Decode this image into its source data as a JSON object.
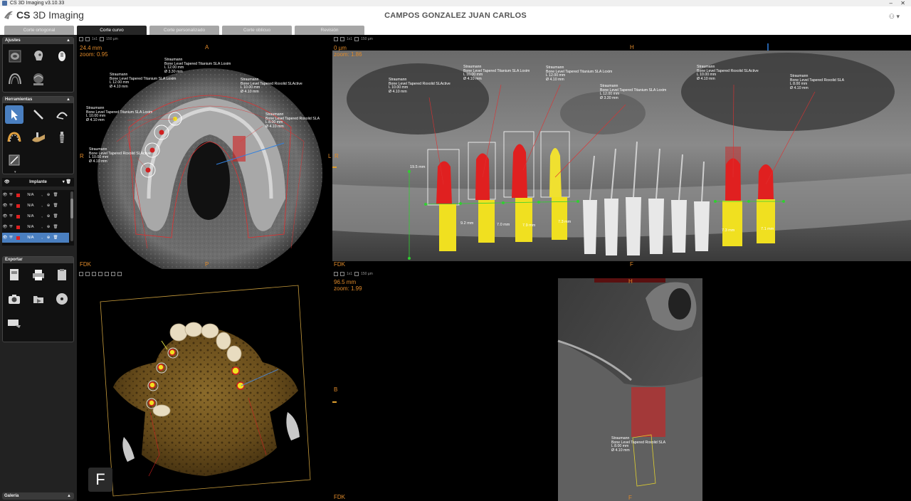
{
  "window": {
    "title": "CS 3D Imaging v3.10.33"
  },
  "header": {
    "logo_bold": "CS",
    "logo_text": "3D Imaging",
    "patient": "CAMPOS GONZALEZ JUAN CARLOS"
  },
  "tabs": [
    {
      "label": "Corte ortogonal",
      "active": false
    },
    {
      "label": "Corte curvo",
      "active": true
    },
    {
      "label": "Corte personalizado",
      "active": false
    },
    {
      "label": "Corte oblicuo",
      "active": false
    },
    {
      "label": "Revisión",
      "active": false
    }
  ],
  "sidebar": {
    "ajustes": "Ajustes",
    "herramientas": "Herramientas",
    "implante": "Implante",
    "exportar": "Exportar",
    "galeria": "Galería",
    "implant_rows": [
      {
        "value": "N/A",
        "selected": false
      },
      {
        "value": "N/A",
        "selected": false
      },
      {
        "value": "N/A",
        "selected": false
      },
      {
        "value": "N/A",
        "selected": false
      },
      {
        "value": "N/A",
        "selected": true
      }
    ]
  },
  "axial": {
    "toolbar_text": "1x1",
    "toolbar_thick": "150 µm",
    "thickness": "24.4 mm",
    "zoom": "zoom: 0.95",
    "orient_top": "A",
    "orient_left": "R",
    "orient_right": "L",
    "orient_bottom": "P",
    "corner": "FDK",
    "labels": [
      {
        "maker": "Straumann",
        "model": "Bone Level Tapered Titanium SLA Loxim",
        "length": "L 12.00 mm",
        "diameter": "Ø 3.30 mm"
      },
      {
        "maker": "Straumann",
        "model": "Bone Level Tapered Titanium SLA Loxim",
        "length": "L 12.00 mm",
        "diameter": "Ø 4.10 mm"
      },
      {
        "maker": "Straumann",
        "model": "Bone Level Tapered Roxolid SLActive",
        "length": "L 10.00 mm",
        "diameter": "Ø 4.10 mm"
      },
      {
        "maker": "Straumann",
        "model": "Bone Level Tapered Titanium SLA Loxim",
        "length": "L 10.00 mm",
        "diameter": "Ø 4.10 mm"
      },
      {
        "maker": "Straumann",
        "model": "Bone Level Tapered Roxolid SLA",
        "length": "L 8.00 mm",
        "diameter": "Ø 4.10 mm"
      },
      {
        "maker": "Straumann",
        "model": "Bone Level Tapered Roxolid SLActive",
        "length": "L 10.00 mm",
        "diameter": "Ø 4.10 mm"
      }
    ]
  },
  "panoramic": {
    "toolbar_text": "1x1",
    "toolbar_thick": "150 µm",
    "thickness": "0 µm",
    "zoom": "zoom: 1.86",
    "orient_top": "H",
    "orient_left": "R",
    "orient_bottom": "F",
    "corner": "FDK",
    "labels": [
      {
        "maker": "Straumann",
        "model": "Bone Level Tapered Roxolid SLActive",
        "length": "L 10.00 mm",
        "diameter": "Ø 4.10 mm"
      },
      {
        "maker": "Straumann",
        "model": "Bone Level Tapered Titanium SLA Loxim",
        "length": "L 10.00 mm",
        "diameter": "Ø 4.10 mm"
      },
      {
        "maker": "Straumann",
        "model": "Bone Level Tapered Titanium SLA Loxim",
        "length": "L 12.00 mm",
        "diameter": "Ø 4.10 mm"
      },
      {
        "maker": "Straumann",
        "model": "Bone Level Tapered Titanium SLA Loxim",
        "length": "L 12.00 mm",
        "diameter": "Ø 3.30 mm"
      },
      {
        "maker": "Straumann",
        "model": "Bone Level Tapered Roxolid SLActive",
        "length": "L 10.00 mm",
        "diameter": "Ø 4.10 mm"
      },
      {
        "maker": "Straumann",
        "model": "Bone Level Tapered Roxolid SLA",
        "length": "L 8.00 mm",
        "diameter": "Ø 4.10 mm"
      }
    ],
    "measurements": [
      "19.5 mm",
      "9.2 mm",
      "7.0 mm",
      "7.9 mm",
      "7.3 mm",
      "7.3 mm",
      "7.1 mm"
    ]
  },
  "render3d": {
    "badge": "F"
  },
  "cross": {
    "toolbar_text": "1x1",
    "toolbar_thick": "150 µm",
    "thickness": "96.5 mm",
    "zoom": "zoom: 1.99",
    "orient_top": "H",
    "orient_left": "B",
    "orient_bottom": "F",
    "corner": "FDK",
    "label": {
      "maker": "Straumann",
      "model": "Bone Level Tapered Roxolid SLA",
      "length": "L 8.00 mm",
      "diameter": "Ø 4.10 mm"
    }
  }
}
